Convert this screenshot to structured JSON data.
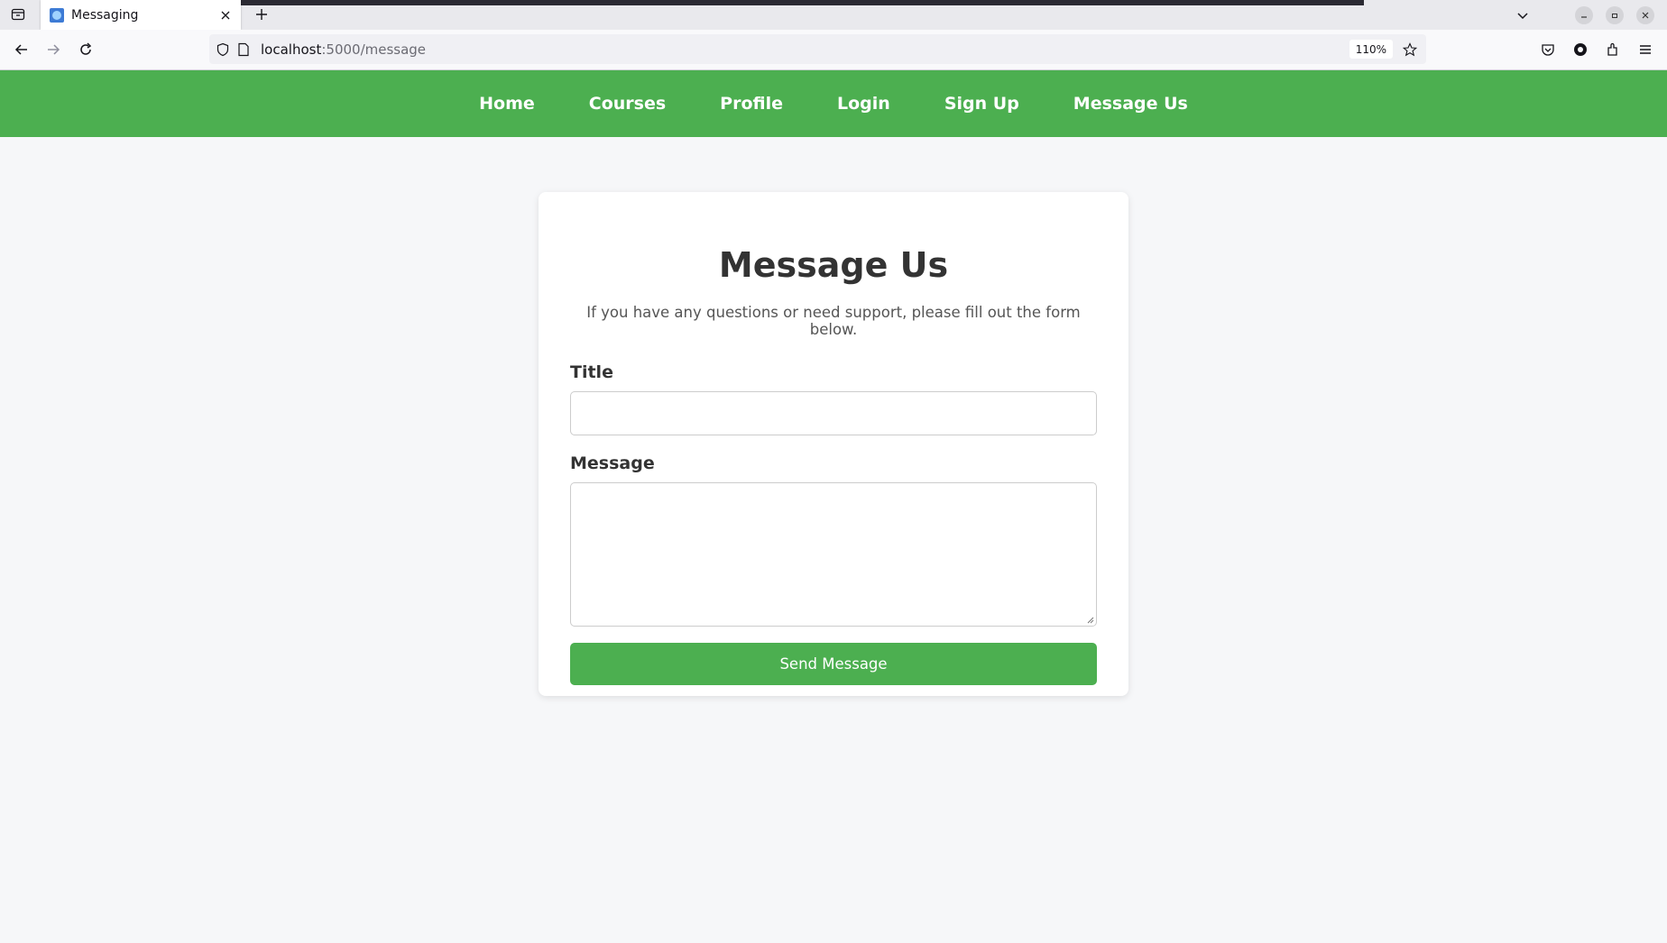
{
  "browser": {
    "tab_title": "Messaging",
    "url_host": "localhost",
    "url_path": ":5000/message",
    "zoom": "110%"
  },
  "nav": {
    "items": [
      "Home",
      "Courses",
      "Profile",
      "Login",
      "Sign Up",
      "Message Us"
    ]
  },
  "form": {
    "heading": "Message Us",
    "lead": "If you have any questions or need support, please fill out the form below.",
    "title_label": "Title",
    "title_value": "",
    "message_label": "Message",
    "message_value": "",
    "submit_label": "Send Message"
  },
  "colors": {
    "brand_green": "#4caf50",
    "page_bg": "#f6f7f9"
  }
}
